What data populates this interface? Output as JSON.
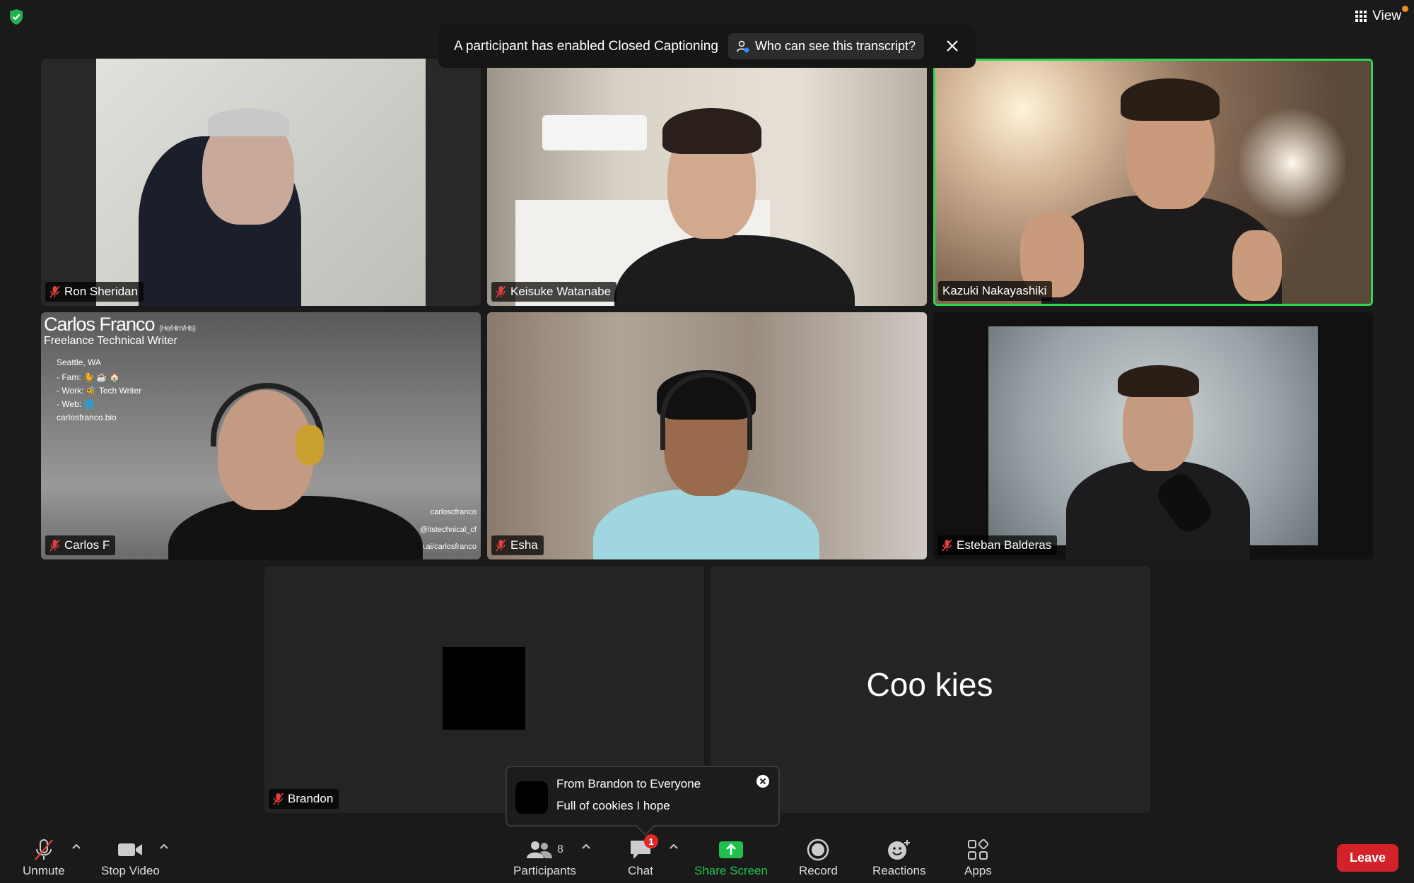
{
  "top": {
    "view_label": "View"
  },
  "banner": {
    "text": "A participant has enabled Closed Captioning",
    "who_label": "Who can see this transcript?"
  },
  "participants": [
    {
      "name": "Ron Sheridan",
      "muted": true
    },
    {
      "name": "Keisuke Watanabe",
      "muted": true
    },
    {
      "name": "Kazuki Nakayashiki",
      "muted": false,
      "active_speaker": true
    },
    {
      "name": "Carlos F",
      "muted": true
    },
    {
      "name": "Esha",
      "muted": true
    },
    {
      "name": "Esteban Balderas",
      "muted": true
    },
    {
      "name": "Brandon",
      "muted": true
    },
    {
      "name": "",
      "display_text": "Coo kies"
    }
  ],
  "carlos_bg": {
    "title": "Carlos Franco",
    "pronouns": "(He/Him/His)",
    "subtitle": "Freelance Technical Writer",
    "lines": [
      "Seattle, WA",
      "- Fam: 🐈 ☕ 🏠",
      "- Work: 🐝 Tech Writer",
      "- Web: 🌐",
      "carlosfranco.bio"
    ],
    "social": [
      "carloscfranco",
      "@itstechnical_cf",
      "army.ai/carlosfranco"
    ]
  },
  "chat_toast": {
    "from": "From Brandon to Everyone",
    "message": "Full of cookies I hope"
  },
  "toolbar": {
    "unmute": "Unmute",
    "stop_video": "Stop Video",
    "participants": "Participants",
    "participants_count": "8",
    "chat": "Chat",
    "chat_badge": "1",
    "share_screen": "Share Screen",
    "record": "Record",
    "reactions": "Reactions",
    "apps": "Apps",
    "leave": "Leave"
  },
  "colors": {
    "active_speaker": "#2ed651",
    "share": "#21c04e",
    "leave": "#d3222a",
    "muted": "#e04040"
  }
}
